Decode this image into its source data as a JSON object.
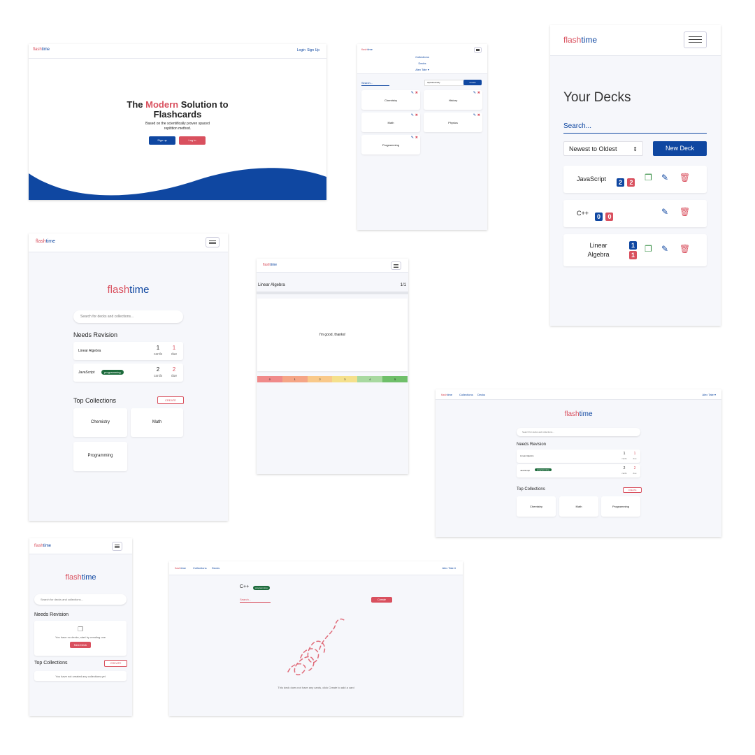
{
  "brand": {
    "flash": "flash",
    "time": "time"
  },
  "landing": {
    "nav": {
      "login": "Login",
      "signup": "Sign Up"
    },
    "hero": {
      "pre": "The ",
      "accent": "Modern",
      "post": " Solution to",
      "line2": "Flashcards",
      "sub1": "Based on the scientifically proven spaced",
      "sub2": "repitition method."
    },
    "buttons": {
      "signup": "Sign up",
      "login": "Log in"
    }
  },
  "collections_shot": {
    "menu": [
      "Collections",
      "Decks",
      "Alex Tate ▾"
    ],
    "search_placeholder": "Search...",
    "sort": "Alphabetically",
    "create": "Create",
    "cards": [
      "Chemistry",
      "History",
      "Math",
      "Physics",
      "Programming"
    ]
  },
  "decks_shot": {
    "title": "Your Decks",
    "search_placeholder": "Search...",
    "sort": "Newest to Oldest",
    "new_deck": "New Deck",
    "decks": [
      {
        "name": "JavaScript",
        "cards": "2",
        "due": "2"
      },
      {
        "name": "C++",
        "cards": "0",
        "due": "0"
      },
      {
        "name": "Linear Algebra",
        "cards": "1",
        "due": "1"
      }
    ]
  },
  "home_mobile": {
    "search_placeholder": "Search for decks and collections...",
    "needs_revision": "Needs Revision",
    "rows": [
      {
        "name": "Linear Algebra",
        "cards": "1",
        "due": "1",
        "cards_label": "cards",
        "due_label": "due"
      },
      {
        "name": "JavaScript",
        "tag": "programming",
        "cards": "2",
        "due": "2",
        "cards_label": "cards",
        "due_label": "due"
      }
    ],
    "top_collections": "Top Collections",
    "create": "CREATE",
    "collections": [
      "Chemistry",
      "Math",
      "Programming"
    ]
  },
  "study_shot": {
    "deck": "Linear Algebra",
    "progress": "1/1",
    "card_text": "I'm good, thanks!",
    "ratings": [
      "0",
      "1",
      "2",
      "3",
      "4",
      "5"
    ]
  },
  "home_desktop": {
    "menu": [
      "Collections",
      "Decks"
    ],
    "user": "Alex Tate ▾",
    "search_placeholder": "Search for decks and collections...",
    "needs_revision": "Needs Revision",
    "rows": [
      {
        "name": "Linear Algebra",
        "cards": "1",
        "due": "1"
      },
      {
        "name": "JavaScript",
        "tag": "programming",
        "cards": "2",
        "due": "2"
      }
    ],
    "cards_label": "cards",
    "due_label": "due",
    "top_collections": "Top Collections",
    "create": "CREATE",
    "collections": [
      "Chemistry",
      "Math",
      "Programming"
    ]
  },
  "empty_mobile": {
    "search_placeholder": "Search for decks and collections...",
    "needs_revision": "Needs Revision",
    "empty_text": "You have no decks, start by creating one",
    "new_deck": "New Deck",
    "top_collections": "Top Collections",
    "create": "CREATE",
    "no_collections": "You have not created any collections yet"
  },
  "empty_deck": {
    "menu": [
      "Collections",
      "Decks"
    ],
    "user": "Alex Tate ▾",
    "deck": "C++",
    "tag": "programming",
    "search_placeholder": "Search...",
    "create": "Create",
    "empty_text": "This deck does not have any cards, click Create to add a card"
  },
  "colors": {
    "navy": "#0f47a1",
    "red": "#d9505e",
    "green": "#1d6b3c",
    "bg": "#f6f7fb"
  }
}
